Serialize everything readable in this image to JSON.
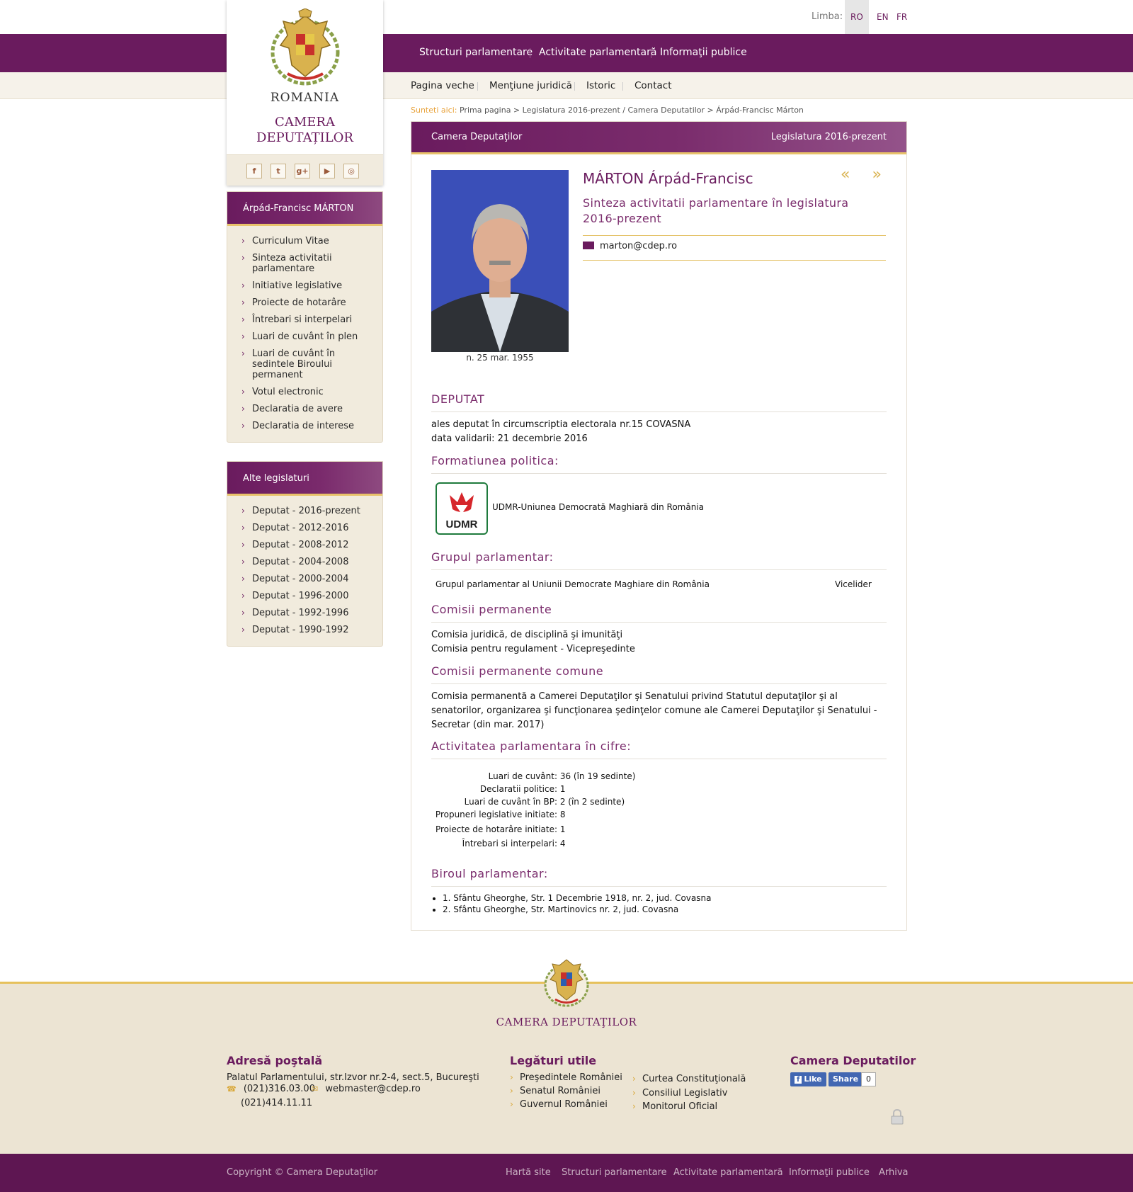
{
  "language": {
    "label": "Limba:",
    "options": [
      "RO",
      "EN",
      "FR"
    ],
    "active": "RO"
  },
  "logo": {
    "country": "ROMANIA",
    "institution_line1": "CAMERA",
    "institution_line2": "DEPUTAȚILOR",
    "social": [
      "f",
      "t",
      "g+",
      "yt",
      "ig"
    ]
  },
  "main_nav": [
    "Structuri parlamentare",
    "Activitate parlamentară",
    "Informaţii publice"
  ],
  "sub_nav": [
    "Pagina veche",
    "Menţiune juridică",
    "Istoric",
    "Contact"
  ],
  "breadcrumb": {
    "label": "Sunteti aici:",
    "path": "Prima pagina > Legislatura 2016-prezent / Camera Deputatilor > Árpád-Francisc Márton"
  },
  "sidebar": {
    "deputy_box": {
      "title": "Árpád-Francisc MÁRTON",
      "items": [
        "Curriculum Vitae",
        "Sinteza activitatii parlamentare",
        "Initiative legislative",
        "Proiecte de hotarâre",
        "Întrebari si interpelari",
        "Luari de cuvânt în plen",
        "Luari de cuvânt în sedintele Biroului permanent",
        "Votul electronic",
        "Declaratia de avere",
        "Declaratia de interese"
      ]
    },
    "legislatures_box": {
      "title": "Alte legislaturi",
      "items": [
        "Deputat  -  2016-prezent",
        "Deputat - 2012-2016",
        "Deputat - 2008-2012",
        "Deputat - 2004-2008",
        "Deputat - 2000-2004",
        "Deputat - 1996-2000",
        "Deputat - 1992-1996",
        "Deputat - 1990-1992"
      ]
    }
  },
  "panel": {
    "header_left": "Camera Deputaţilor",
    "header_right": "Legislatura 2016-prezent",
    "name": "MÁRTON Árpád-Francisc",
    "nav_arrows": "« »",
    "sinteza": "Sinteza activitatii parlamentare în legislatura 2016-prezent",
    "email": "marton@cdep.ro",
    "birth": "n. 25 mar. 1955",
    "deputat_title": "DEPUTAT",
    "deputat_line1": "ales deputat în circumscriptia electorala nr.15 COVASNA",
    "deputat_line2": "data validarii: 21 decembrie 2016",
    "formatiune_title": "Formatiunea politica:",
    "party_logo_text": "UDMR",
    "party_name": "UDMR-Uniunea Democrată Maghiară din România",
    "grup_title": "Grupul parlamentar:",
    "grup_name": "Grupul parlamentar al Uniunii Democrate Maghiare din România",
    "grup_role": "Vicelider",
    "comisii_title": "Comisii permanente",
    "comisii_line1": "Comisia juridică, de disciplină şi imunităţi",
    "comisii_line2": "Comisia pentru regulament - Vicepreşedinte",
    "comune_title": "Comisii permanente comune",
    "comune_text": "Comisia permanentă a Camerei Deputaţilor şi Senatului privind Statutul deputaţilor şi al senatorilor, organizarea şi funcţionarea şedinţelor comune ale Camerei Deputaţilor şi Senatului - Secretar (din mar. 2017)",
    "activitate_title": "Activitatea parlamentara în cifre:",
    "stats": [
      {
        "label": "Luari de cuvânt:",
        "value": "36 (în 19 sedinte)"
      },
      {
        "label": "Declaratii politice:",
        "value": "1"
      },
      {
        "label": "Luari de cuvânt în BP:",
        "value": "2 (în 2 sedinte)"
      },
      {
        "label": "Propuneri legislative initiate:",
        "value": "8"
      },
      {
        "label": "Proiecte de hotarâre initiate:",
        "value": "1"
      },
      {
        "label": "Întrebari si interpelari:",
        "value": "4"
      }
    ],
    "birou_title": "Biroul parlamentar:",
    "birou_items": [
      "1. Sfântu Gheorghe, Str. 1 Decembrie 1918, nr. 2, jud. Covasna",
      "2. Sfântu Gheorghe, Str. Martinovics nr. 2, jud. Covasna"
    ]
  },
  "footer": {
    "institution": "CAMERA DEPUTAŢILOR",
    "address_title": "Adresă poştală",
    "address": "Palatul Parlamentului, str.Izvor nr.2-4, sect.5, Bucureşti",
    "phone1": "(021)316.03.00",
    "email": "webmaster@cdep.ro",
    "phone2": "(021)414.11.11",
    "links_title": "Legături utile",
    "links_col1": [
      "Preşedintele României",
      "Senatul României",
      "Guvernul României"
    ],
    "links_col2": [
      "Curtea Constituţională",
      "Consiliul Legislativ",
      "Monitorul Oficial"
    ],
    "social_title": "Camera Deputatilor",
    "fb_like": "Like",
    "fb_share": "Share",
    "fb_count": "0"
  },
  "bottom_bar": {
    "copyright": "Copyright © Camera Deputaţilor",
    "links": [
      "Hartă site",
      "Structuri parlamentare",
      "Activitate parlamentară",
      "Informaţii publice",
      "Arhiva"
    ]
  },
  "colors": {
    "brand_purple": "#6a1b5e",
    "gold": "#e8c26a",
    "sidebar_bg": "#f1ebdd",
    "footer_bg": "#ece4d3"
  }
}
